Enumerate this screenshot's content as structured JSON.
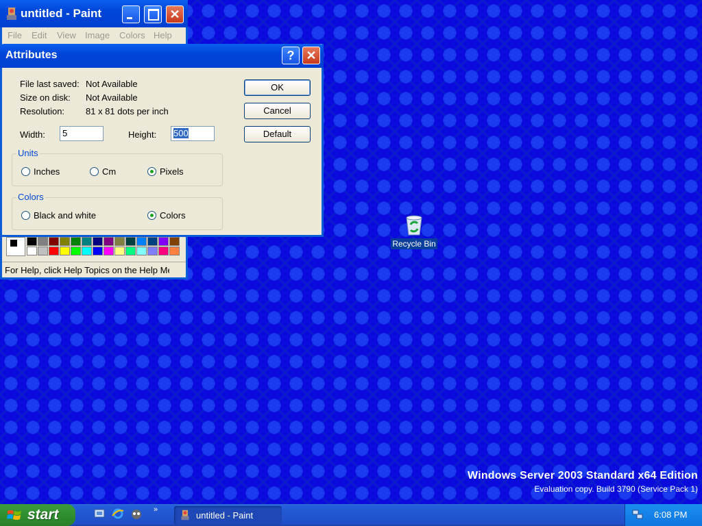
{
  "desktop": {
    "recycle_bin_label": "Recycle Bin",
    "watermark": {
      "line1": "Windows Server 2003 Standard x64 Edition",
      "line2": "Evaluation copy. Build 3790 (Service Pack 1)"
    }
  },
  "paint_window": {
    "title": "untitled - Paint",
    "menu": [
      "File",
      "Edit",
      "View",
      "Image",
      "Colors",
      "Help"
    ],
    "status": "For Help, click Help Topics on the Help Me",
    "palette_top": [
      "#000000",
      "#808080",
      "#800000",
      "#808000",
      "#008000",
      "#008080",
      "#000080",
      "#800080",
      "#808040",
      "#004040",
      "#0080ff",
      "#004080",
      "#8000ff",
      "#804000"
    ],
    "palette_bottom": [
      "#ffffff",
      "#c0c0c0",
      "#ff0000",
      "#ffff00",
      "#00ff00",
      "#00ffff",
      "#0000ff",
      "#ff00ff",
      "#ffff80",
      "#00ff80",
      "#80ffff",
      "#8080ff",
      "#ff0080",
      "#ff8040"
    ]
  },
  "dialog": {
    "title": "Attributes",
    "help_glyph": "?",
    "close_glyph": "✕",
    "file_last_saved_label": "File last saved:",
    "file_last_saved_value": "Not Available",
    "size_on_disk_label": "Size on disk:",
    "size_on_disk_value": "Not Available",
    "resolution_label": "Resolution:",
    "resolution_value": "81 x 81 dots per inch",
    "width_label": "Width:",
    "width_value": "5",
    "height_label": "Height:",
    "height_value": "500",
    "units_group": "Units",
    "units": [
      {
        "label": "Inches",
        "selected": false
      },
      {
        "label": "Cm",
        "selected": false
      },
      {
        "label": "Pixels",
        "selected": true
      }
    ],
    "colors_group": "Colors",
    "colors": [
      {
        "label": "Black and white",
        "selected": false
      },
      {
        "label": "Colors",
        "selected": true
      }
    ],
    "buttons": {
      "ok": "OK",
      "cancel": "Cancel",
      "default": "Default"
    }
  },
  "taskbar": {
    "start_label": "start",
    "task_paint": "untitled - Paint",
    "quicklaunch_more": "»",
    "clock": "6:08 PM"
  }
}
